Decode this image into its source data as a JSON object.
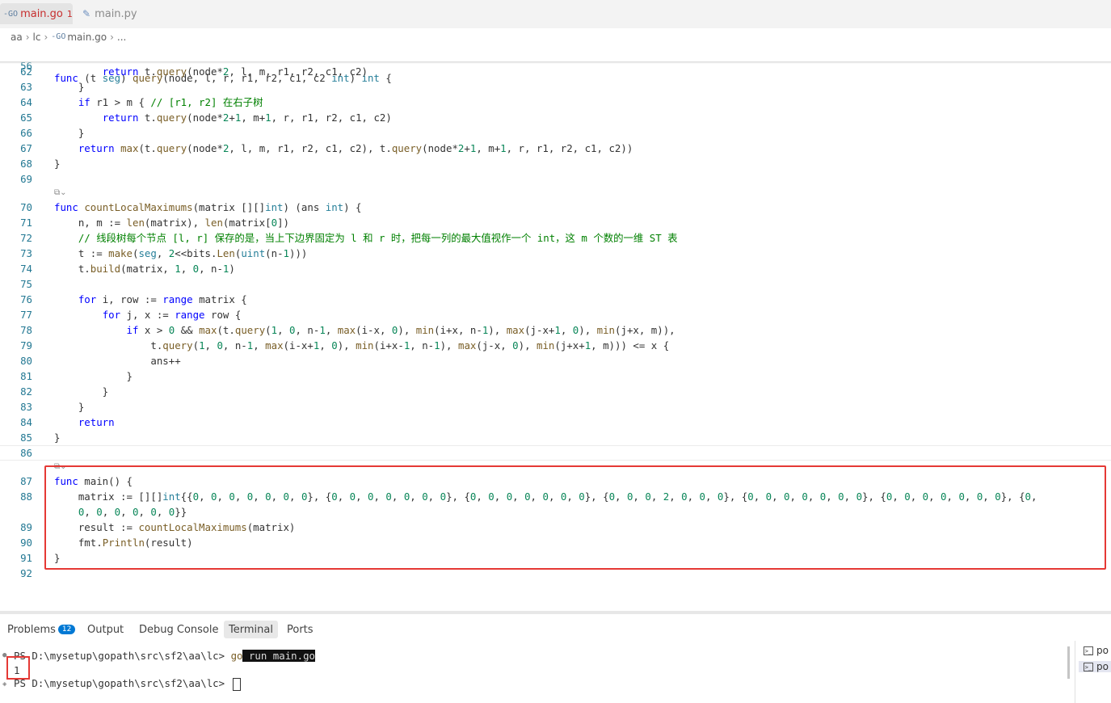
{
  "tabs": [
    {
      "icon": "go-file-icon",
      "label": "main.go",
      "badge": "1",
      "active": true
    },
    {
      "icon": "python-file-icon",
      "label": "main.py",
      "active": false
    }
  ],
  "breadcrumb": {
    "parts": [
      "aa",
      "lc",
      "main.go",
      "..."
    ]
  },
  "editor": {
    "sticky_line": {
      "num": "56",
      "text": "func (t seg) query(node, l, r, r1, r2, c1, c2 int) int {"
    },
    "lines": [
      {
        "num": "62",
        "text": "        return t.query(node*2, l, m, r1, r2, c1, c2)"
      },
      {
        "num": "63",
        "text": "    }"
      },
      {
        "num": "64",
        "text": "    if r1 > m { // [r1, r2] 在右子树"
      },
      {
        "num": "65",
        "text": "        return t.query(node*2+1, m+1, r, r1, r2, c1, c2)"
      },
      {
        "num": "66",
        "text": "    }"
      },
      {
        "num": "67",
        "text": "    return max(t.query(node*2, l, m, r1, r2, c1, c2), t.query(node*2+1, m+1, r, r1, r2, c1, c2))"
      },
      {
        "num": "68",
        "text": "}"
      },
      {
        "num": "69",
        "text": ""
      },
      {
        "num": "70",
        "text": "func countLocalMaximums(matrix [][]int) (ans int) {"
      },
      {
        "num": "71",
        "text": "    n, m := len(matrix), len(matrix[0])"
      },
      {
        "num": "72",
        "text": "    // 线段树每个节点 [l, r] 保存的是，当上下边界固定为 l 和 r 时，把每一列的最大值视作一个 int，这 m 个数的一维 ST 表"
      },
      {
        "num": "73",
        "text": "    t := make(seg, 2<<bits.Len(uint(n-1)))"
      },
      {
        "num": "74",
        "text": "    t.build(matrix, 1, 0, n-1)"
      },
      {
        "num": "75",
        "text": ""
      },
      {
        "num": "76",
        "text": "    for i, row := range matrix {"
      },
      {
        "num": "77",
        "text": "        for j, x := range row {"
      },
      {
        "num": "78",
        "text": "            if x > 0 && max(t.query(1, 0, n-1, max(i-x, 0), min(i+x, n-1), max(j-x+1, 0), min(j+x, m)),"
      },
      {
        "num": "79",
        "text": "                t.query(1, 0, n-1, max(i-x+1, 0), min(i+x-1, n-1), max(j-x, 0), min(j+x+1, m))) <= x {"
      },
      {
        "num": "80",
        "text": "                ans++"
      },
      {
        "num": "81",
        "text": "            }"
      },
      {
        "num": "82",
        "text": "        }"
      },
      {
        "num": "83",
        "text": "    }"
      },
      {
        "num": "84",
        "text": "    return"
      },
      {
        "num": "85",
        "text": "}"
      },
      {
        "num": "86",
        "text": ""
      },
      {
        "num": "87",
        "text": "func main() {"
      },
      {
        "num": "88",
        "text": "    matrix := [][]int{{0, 0, 0, 0, 0, 0, 0}, {0, 0, 0, 0, 0, 0, 0}, {0, 0, 0, 0, 0, 0, 0}, {0, 0, 0, 2, 0, 0, 0}, {0, 0, 0, 0, 0, 0, 0}, {0, 0, 0, 0, 0, 0, 0}, {0,"
      },
      {
        "num": "",
        "text": "    0, 0, 0, 0, 0, 0}}"
      },
      {
        "num": "89",
        "text": "    result := countLocalMaximums(matrix)"
      },
      {
        "num": "90",
        "text": "    fmt.Println(result)"
      },
      {
        "num": "91",
        "text": "}"
      },
      {
        "num": "92",
        "text": ""
      }
    ]
  },
  "panel": {
    "tabs": [
      {
        "label": "Problems",
        "badge": "12"
      },
      {
        "label": "Output"
      },
      {
        "label": "Debug Console"
      },
      {
        "label": "Terminal",
        "active": true
      },
      {
        "label": "Ports"
      }
    ]
  },
  "terminal": {
    "prompt1": "PS D:\\mysetup\\gopath\\src\\sf2\\aa\\lc> ",
    "cmd_go": "go",
    "cmd_rest": " run main.go",
    "output": "1",
    "prompt2": "PS D:\\mysetup\\gopath\\src\\sf2\\aa\\lc> "
  },
  "terminal_list": [
    {
      "label": "po",
      "icon": "terminal-icon"
    },
    {
      "label": "po",
      "icon": "terminal-icon",
      "active": true
    }
  ]
}
